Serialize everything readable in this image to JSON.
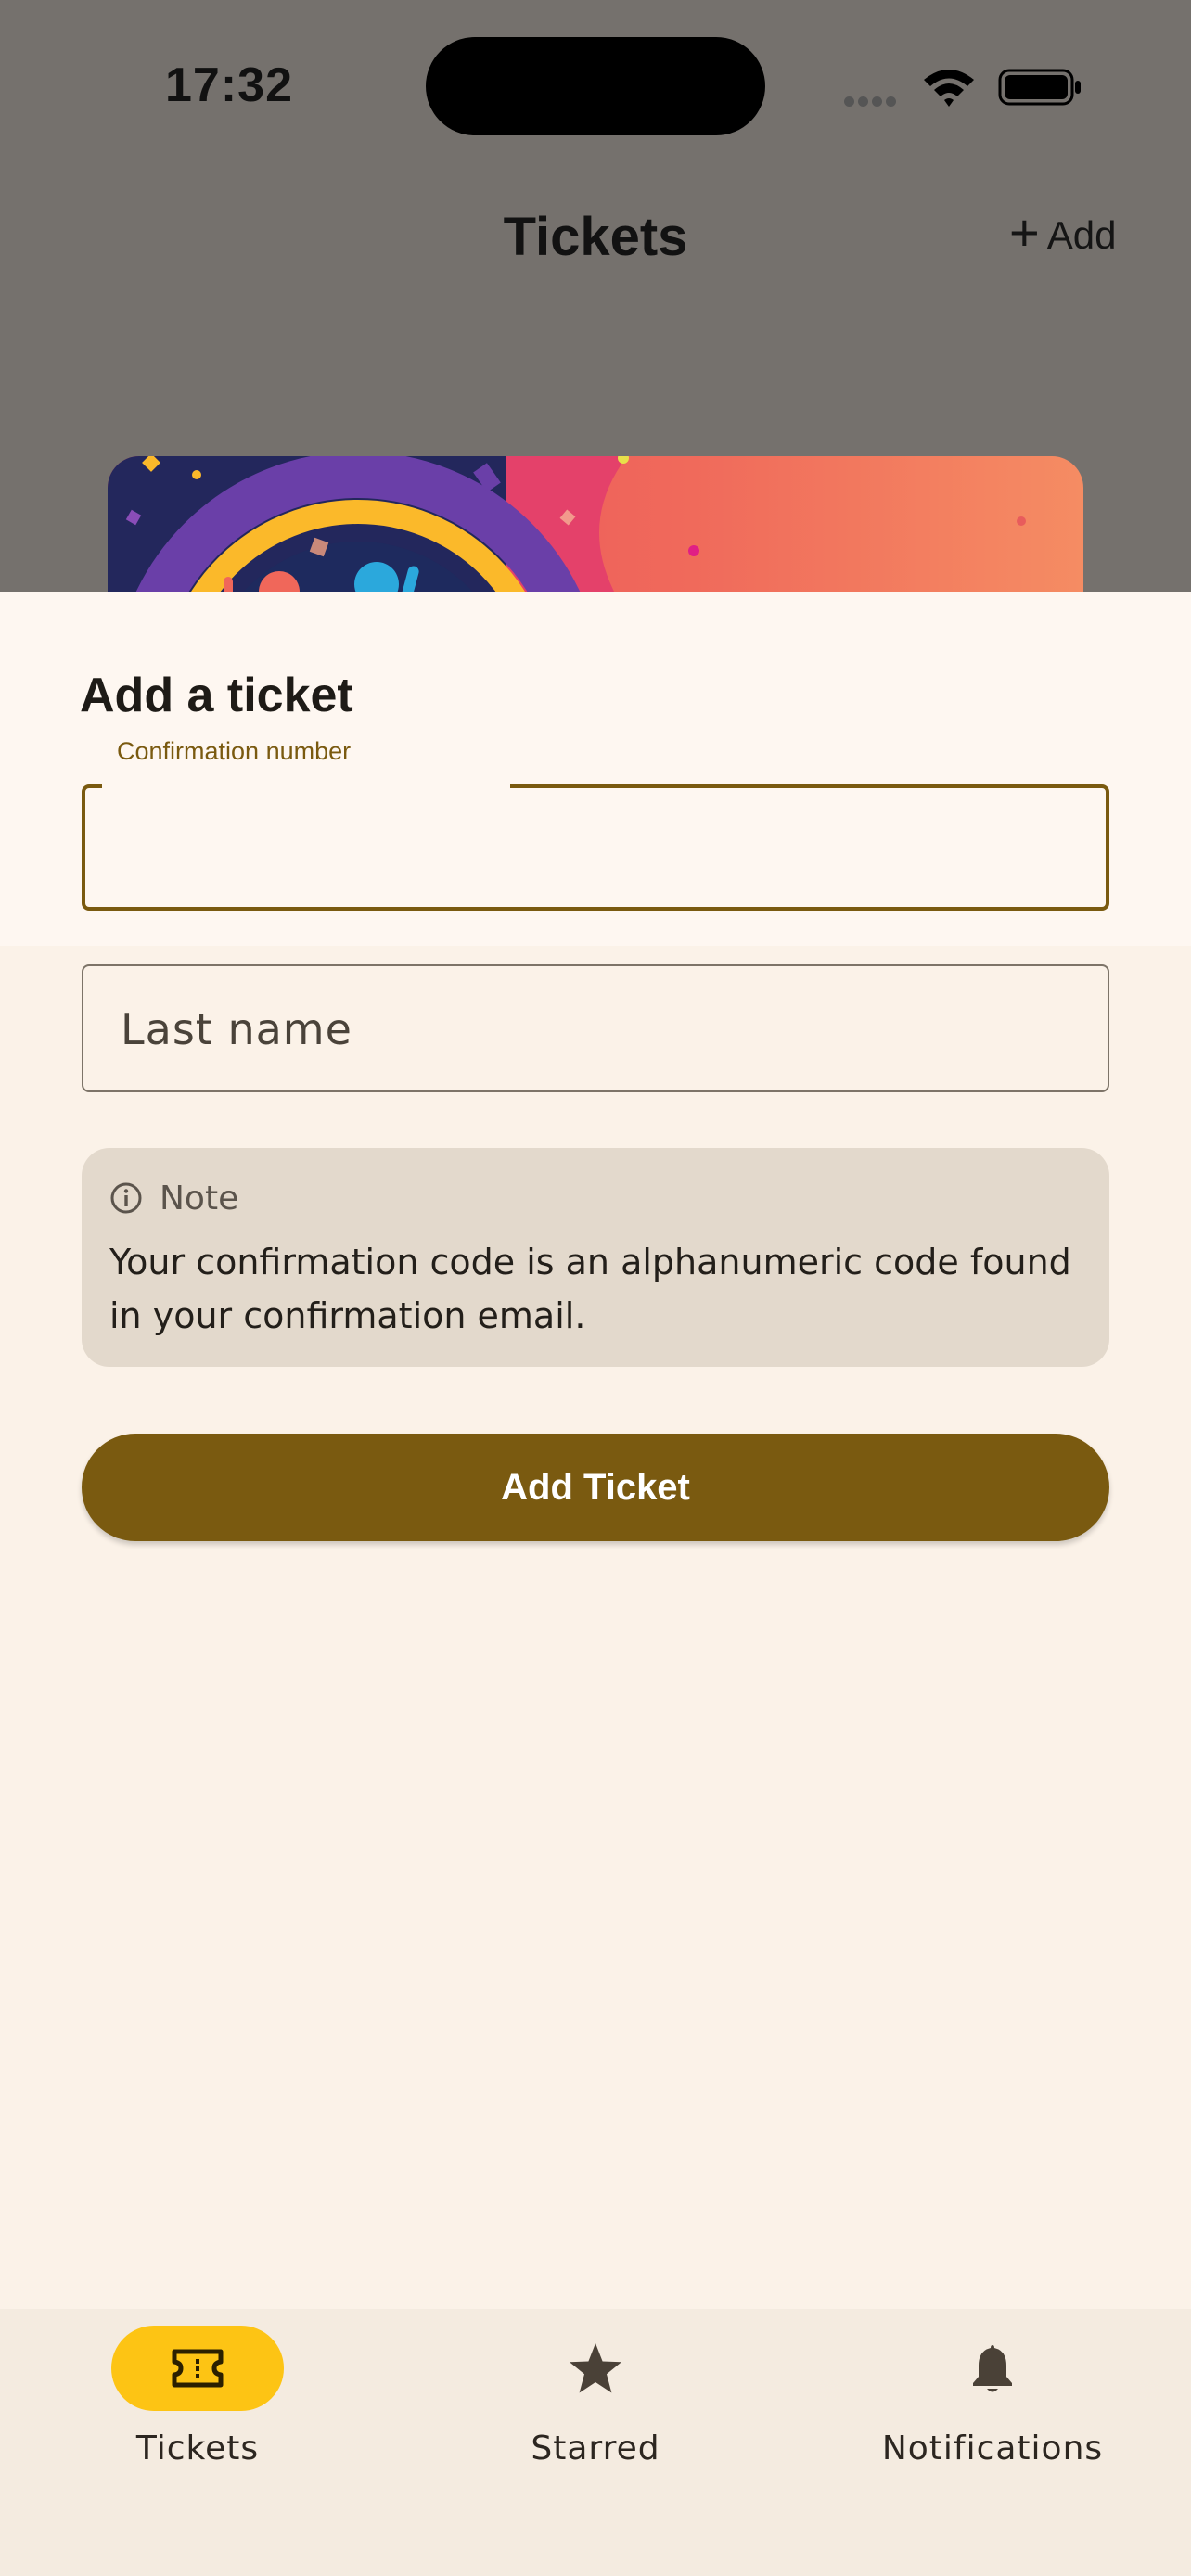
{
  "status_bar": {
    "time": "17:32"
  },
  "nav": {
    "title": "Tickets",
    "add_label": "Add"
  },
  "sheet": {
    "title": "Add a ticket",
    "confirmation": {
      "label": "Confirmation number",
      "value": ""
    },
    "last_name": {
      "placeholder": "Last name",
      "value": ""
    },
    "note": {
      "title": "Note",
      "body": "Your confirmation code is an alphanumeric code found in your confirmation email."
    },
    "submit_label": "Add Ticket"
  },
  "tabs": [
    {
      "label": "Tickets",
      "icon": "ticket-icon",
      "selected": true
    },
    {
      "label": "Starred",
      "icon": "star-icon",
      "selected": false
    },
    {
      "label": "Notifications",
      "icon": "bell-icon",
      "selected": false
    }
  ],
  "colors": {
    "primary": "#7A5A10",
    "tab_selected": "#FDC414",
    "sheet_background": "#FEF7F1",
    "page_background": "#FBF2E8",
    "note_background": "#E3D9CC",
    "scrim": "#75716D"
  }
}
